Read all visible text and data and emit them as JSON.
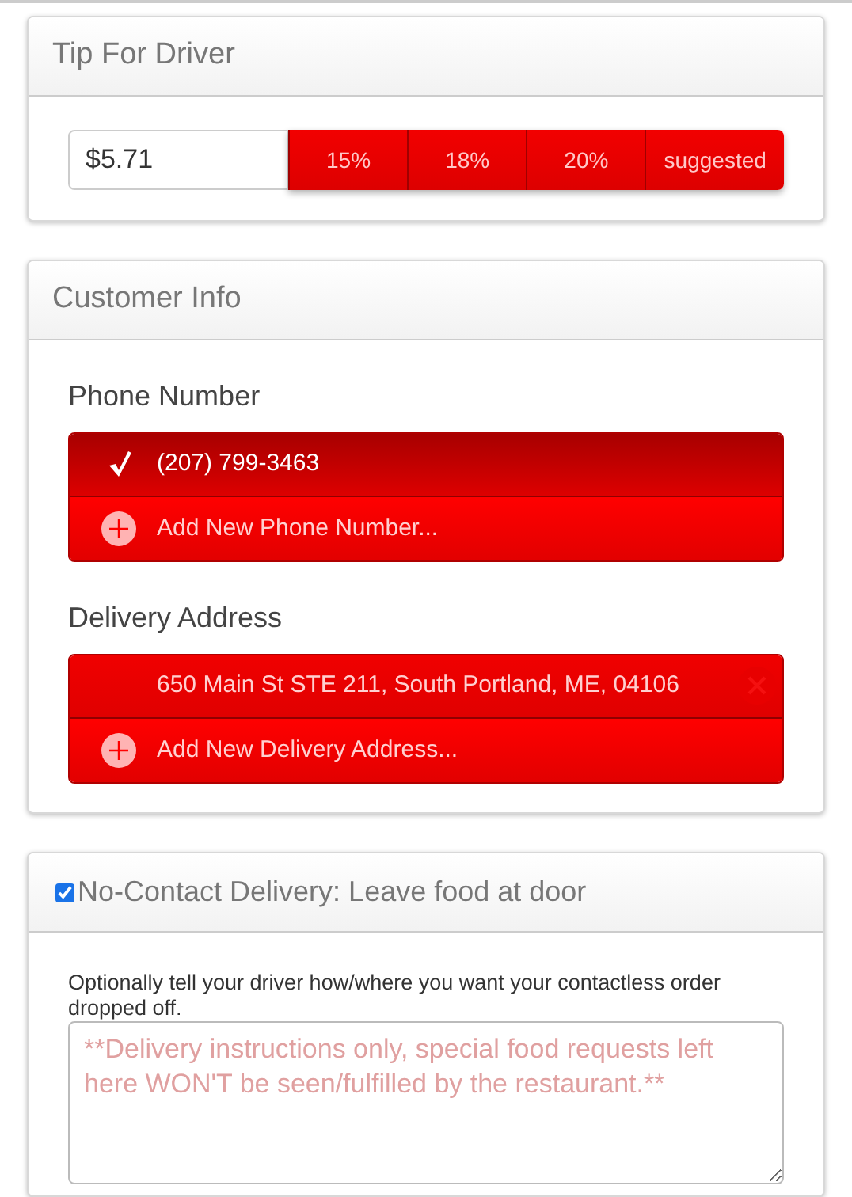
{
  "tip": {
    "title": "Tip For Driver",
    "value": "$5.71",
    "options": [
      {
        "label": "15%",
        "selected": false
      },
      {
        "label": "18%",
        "selected": false
      },
      {
        "label": "20%",
        "selected": false
      },
      {
        "label": "suggested",
        "selected": false
      }
    ]
  },
  "customer_info": {
    "title": "Customer Info",
    "phone": {
      "label": "Phone Number",
      "items": [
        {
          "kind": "option",
          "text": "(207) 799-3463",
          "selected": true
        },
        {
          "kind": "add",
          "text": "Add New Phone Number..."
        }
      ]
    },
    "address": {
      "label": "Delivery Address",
      "items": [
        {
          "kind": "option",
          "text": "650 Main St STE 211, South Portland, ME, 04106",
          "selected": false,
          "removable": true
        },
        {
          "kind": "add",
          "text": "Add New Delivery Address..."
        }
      ]
    }
  },
  "no_contact": {
    "checked": true,
    "title": "No-Contact Delivery: Leave food at door",
    "hint": "Optionally tell your driver how/where you want your contactless order dropped off.",
    "placeholder": "**Delivery instructions only, special food requests left here WON'T be seen/fulfilled by the restaurant.**"
  }
}
